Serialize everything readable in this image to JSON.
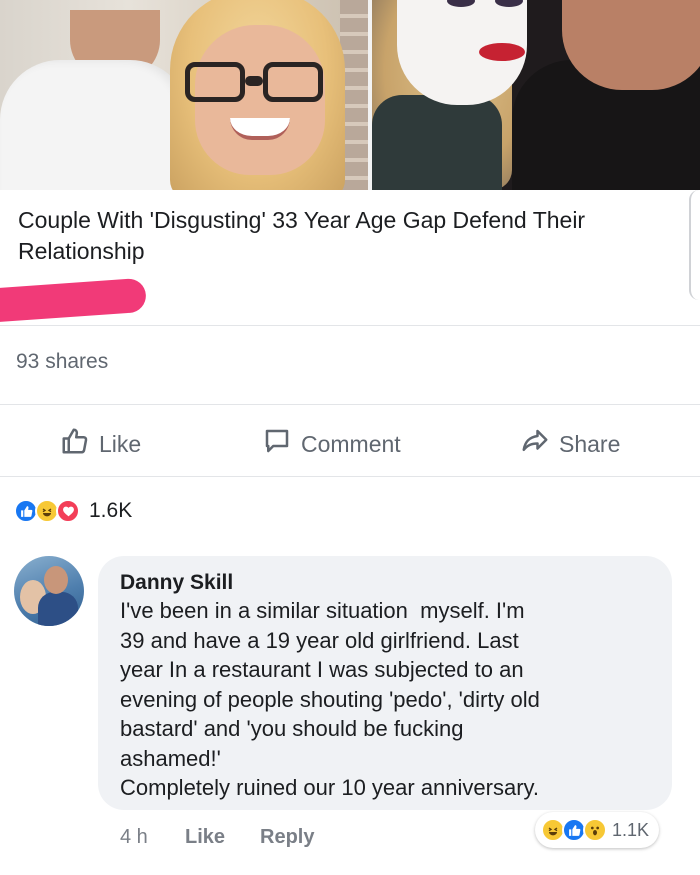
{
  "post": {
    "headline": "Couple With 'Disgusting' 33 Year Age Gap Defend Their Relationship",
    "shares": "93 shares",
    "actions": {
      "like": "Like",
      "comment": "Comment",
      "share": "Share"
    },
    "reactions": {
      "icons": [
        "like-icon",
        "haha-icon",
        "love-icon"
      ],
      "count": "1.6K"
    }
  },
  "comment": {
    "author": "Danny Skill",
    "text": "I've been in a similar situation  myself. I'm\n39 and have a 19 year old girlfriend. Last\nyear In a restaurant I was subjected to an\nevening of people shouting 'pedo', 'dirty old\nbastard' and 'you should be fucking\nashamed!'\nCompletely ruined our 10 year anniversary.",
    "time": "4 h",
    "like_label": "Like",
    "reply_label": "Reply",
    "reactions": {
      "icons": [
        "haha-icon",
        "like-icon",
        "wow-icon"
      ],
      "count": "1.1K"
    }
  },
  "colors": {
    "like_blue": "#1877f2",
    "love_red": "#f33e58",
    "haha_yellow": "#f7c835",
    "highlight_pink": "#f13a78"
  }
}
